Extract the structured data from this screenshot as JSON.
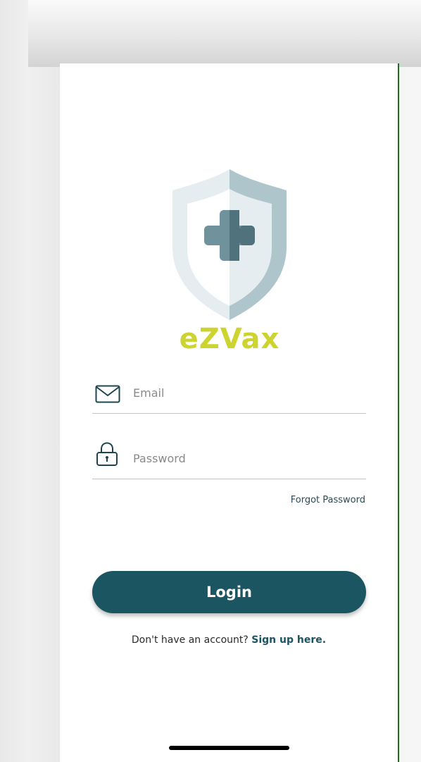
{
  "app": {
    "brand_name": "eZVax",
    "brand_color": "#cdd32f",
    "accent_color": "#1c5562",
    "logo_icon": "shield-medical-cross-icon"
  },
  "login_form": {
    "email": {
      "icon": "envelope-icon",
      "placeholder": "Email",
      "value": ""
    },
    "password": {
      "icon": "padlock-icon",
      "placeholder": "Password",
      "value": ""
    },
    "forgot_password_label": "Forgot Password",
    "login_label": "Login"
  },
  "signup": {
    "prompt": "Don't have an account?",
    "link_label": "Sign up here."
  }
}
